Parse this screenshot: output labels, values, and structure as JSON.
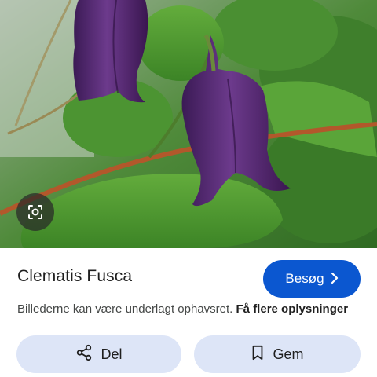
{
  "image": {
    "subject": "Clematis Fusca",
    "colors": {
      "leaf": "#4e9a2e",
      "flower": "#5b2a7a",
      "stem": "#b2582b"
    }
  },
  "lens": {
    "icon": "lens-camera-icon"
  },
  "title": "Clematis Fusca",
  "visit": {
    "label": "Besøg",
    "icon": "chevron-right-icon",
    "color": "#0b57d0"
  },
  "notice": {
    "text": "Billederne kan være underlagt ophavsret.",
    "link": "Få flere oplysninger"
  },
  "actions": {
    "share": {
      "label": "Del",
      "icon": "share-icon"
    },
    "save": {
      "label": "Gem",
      "icon": "bookmark-icon"
    },
    "bg": "#dde5f7"
  }
}
